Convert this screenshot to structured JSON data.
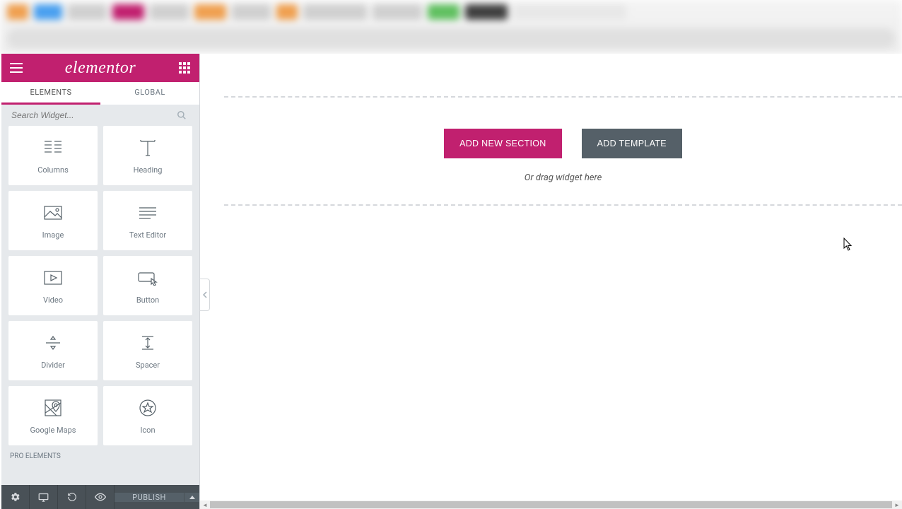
{
  "colors": {
    "accent": "#c1206f",
    "secondary": "#556068"
  },
  "brand": {
    "name": "elementor"
  },
  "panel": {
    "tabs": {
      "elements": "ELEMENTS",
      "global": "GLOBAL"
    },
    "search_placeholder": "Search Widget...",
    "widgets": [
      {
        "id": "columns",
        "label": "Columns"
      },
      {
        "id": "heading",
        "label": "Heading"
      },
      {
        "id": "image",
        "label": "Image"
      },
      {
        "id": "text-editor",
        "label": "Text Editor"
      },
      {
        "id": "video",
        "label": "Video"
      },
      {
        "id": "button",
        "label": "Button"
      },
      {
        "id": "divider",
        "label": "Divider"
      },
      {
        "id": "spacer",
        "label": "Spacer"
      },
      {
        "id": "google-maps",
        "label": "Google Maps"
      },
      {
        "id": "icon",
        "label": "Icon"
      }
    ],
    "next_category": "PRO ELEMENTS",
    "footer": {
      "publish": "PUBLISH"
    }
  },
  "canvas": {
    "add_section": "ADD NEW SECTION",
    "add_template": "ADD TEMPLATE",
    "drag_hint": "Or drag widget here"
  }
}
